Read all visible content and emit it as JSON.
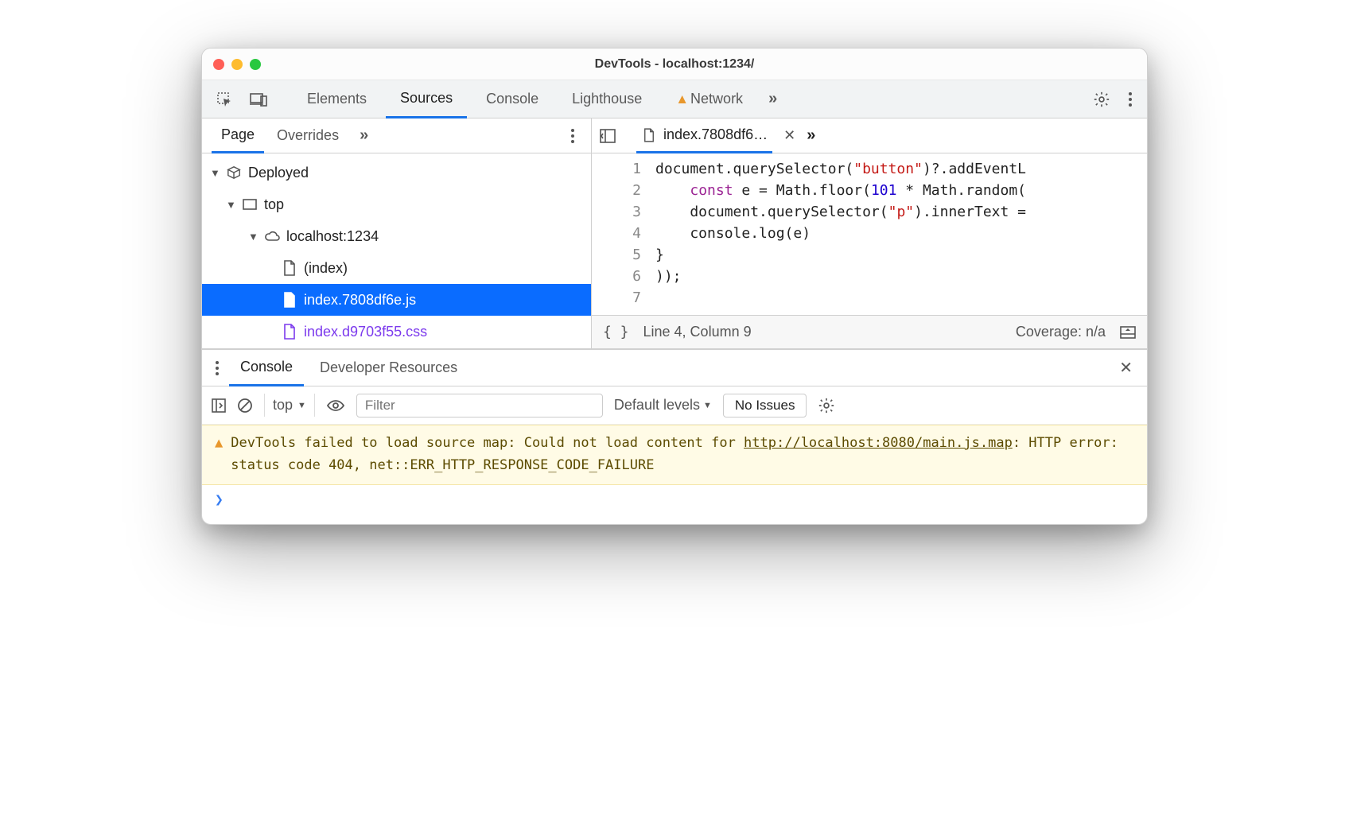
{
  "window": {
    "title": "DevTools - localhost:1234/"
  },
  "main_tabs": {
    "elements": "Elements",
    "sources": "Sources",
    "console": "Console",
    "lighthouse": "Lighthouse",
    "network": "Network"
  },
  "sources": {
    "nav_tabs": {
      "page": "Page",
      "overrides": "Overrides"
    },
    "tree": {
      "deployed": "Deployed",
      "top": "top",
      "host": "localhost:1234",
      "index": "(index)",
      "js": "index.7808df6e.js",
      "css": "index.d9703f55.css"
    }
  },
  "editor": {
    "tab_label": "index.7808df6…",
    "gutter": [
      "1",
      "2",
      "3",
      "4",
      "5",
      "6",
      "7"
    ],
    "code": {
      "l1a": "document.querySelector(",
      "l1b": "\"button\"",
      "l1c": ")?.addEventL",
      "l2a": "    ",
      "l2kw": "const",
      "l2b": " e = Math.floor(",
      "l2num": "101",
      "l2c": " * Math.random(",
      "l3a": "    document.querySelector(",
      "l3b": "\"p\"",
      "l3c": ").innerText =",
      "l4": "    console.log(e)",
      "l5": "}",
      "l6": "));",
      "l7": ""
    },
    "status": {
      "pos": "Line 4, Column 9",
      "coverage": "Coverage: n/a"
    }
  },
  "drawer": {
    "tabs": {
      "console": "Console",
      "devres": "Developer Resources"
    }
  },
  "console": {
    "context": "top",
    "filter_placeholder": "Filter",
    "levels": "Default levels",
    "issues": "No Issues",
    "warning": {
      "pre": "DevTools failed to load source map: Could not load content for ",
      "link": "http://localhost:8080/main.js.map",
      "post": ": HTTP error: status code 404, net::ERR_HTTP_RESPONSE_CODE_FAILURE"
    }
  }
}
